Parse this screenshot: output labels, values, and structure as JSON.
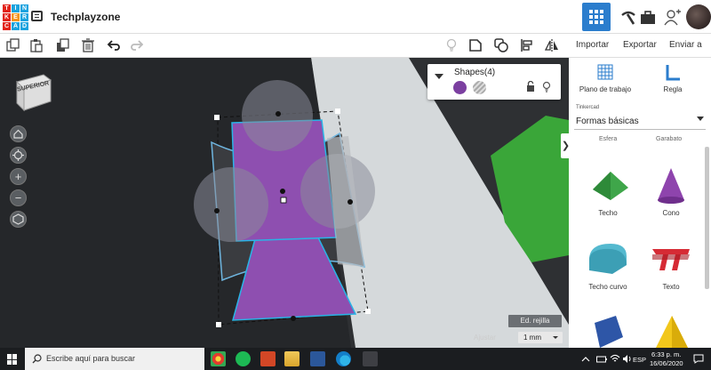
{
  "header": {
    "logo_letters": [
      "T",
      "I",
      "N",
      "K",
      "E",
      "R",
      "C",
      "A",
      "D"
    ],
    "project_title": "Techplayzone"
  },
  "toolbar": {
    "import_label": "Importar",
    "export_label": "Exportar",
    "send_label": "Enviar a"
  },
  "viewport": {
    "view_cube_label": "SUPERIOR",
    "zoom_in": "+",
    "zoom_out": "−"
  },
  "shapes_panel": {
    "title": "Shapes(4)",
    "solid_color": "#7b3fa0"
  },
  "grid": {
    "edit_grid_label": "Ed. rejilla",
    "snap_label": "Ajustar",
    "snap_value": "1 mm"
  },
  "sidebar": {
    "workplane_label": "Plano de trabajo",
    "ruler_label": "Regla",
    "library_category": "Tinkercad",
    "library_value": "Formas básicas",
    "cut_labels": [
      "Esfera",
      "Garabato"
    ],
    "shapes": [
      {
        "label": "Techo",
        "color": "#3fa64a"
      },
      {
        "label": "Cono",
        "color": "#8e44ad"
      },
      {
        "label": "Techo curvo",
        "color": "#54b9cf"
      },
      {
        "label": "Texto",
        "color": "#d62b35"
      }
    ]
  },
  "taskbar": {
    "search_placeholder": "Escribe aquí para buscar",
    "language": "ESP",
    "time": "6:33 p. m.",
    "date": "16/06/2020"
  },
  "colors": {
    "accent": "#2b7dcd",
    "workplane": "#2e3033",
    "ground_plane": "#d8dcde",
    "green_box": "#3aa639"
  }
}
